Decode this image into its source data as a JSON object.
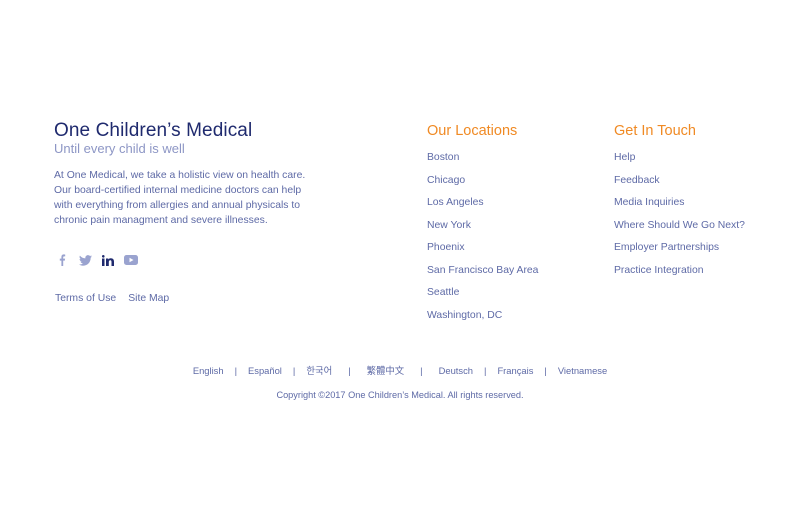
{
  "brand": {
    "title": "One Children’s Medical",
    "tagline": "Until every child is well",
    "description": "At One Medical, we take a holistic view on health care. Our board-certified internal medicine doctors can help with everything from allergies and annual physicals to chronic pain managment and severe illnesses."
  },
  "social": [
    {
      "icon": "facebook-icon"
    },
    {
      "icon": "twitter-icon"
    },
    {
      "icon": "linkedin-icon"
    },
    {
      "icon": "youtube-icon"
    }
  ],
  "legal": {
    "terms": "Terms of Use",
    "sitemap": "Site Map"
  },
  "locations": {
    "heading": "Our Locations",
    "items": [
      "Boston",
      "Chicago",
      "Los Angeles",
      "New York",
      "Phoenix",
      "San Francisco Bay Area",
      "Seattle",
      "Washington, DC"
    ]
  },
  "contact": {
    "heading": "Get In Touch",
    "items": [
      "Help",
      "Feedback",
      "Media Inquiries",
      "Where Should We Go Next?",
      "Employer Partnerships",
      "Practice Integration"
    ]
  },
  "languages": [
    "English",
    "Español",
    "한국어",
    "繁體中文",
    "Deutsch",
    "Français",
    "Vietnamese"
  ],
  "copyright": "Copyright ©2017 One Children’s Medical. All rights reserved.",
  "colors": {
    "navy": "#1f2a6e",
    "accent": "#f08a24",
    "text": "#5e6aa6",
    "muted": "#8d96c5"
  }
}
